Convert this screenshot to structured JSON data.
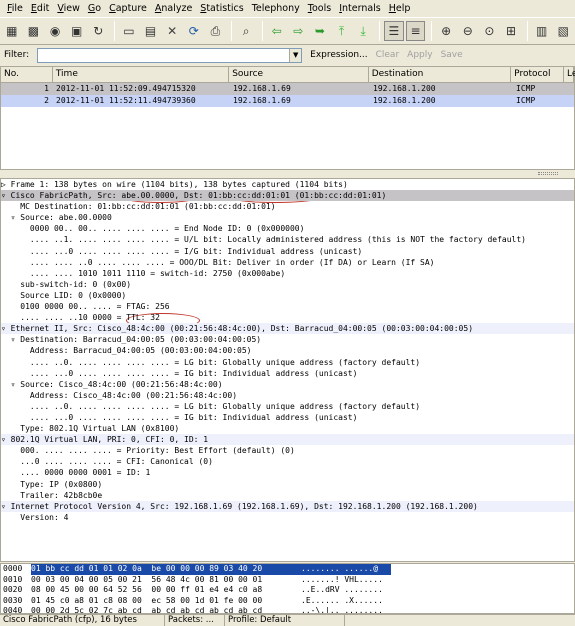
{
  "menu": [
    {
      "u": "F",
      "rest": "ile"
    },
    {
      "u": "E",
      "rest": "dit"
    },
    {
      "u": "V",
      "rest": "iew"
    },
    {
      "u": "G",
      "rest": "o"
    },
    {
      "u": "C",
      "rest": "apture"
    },
    {
      "u": "A",
      "rest": "nalyze"
    },
    {
      "u": "S",
      "rest": "tatistics"
    },
    {
      "u": "",
      "rest": "Telephony"
    },
    {
      "u": "T",
      "rest": "ools"
    },
    {
      "u": "I",
      "rest": "nternals"
    },
    {
      "u": "H",
      "rest": "elp"
    }
  ],
  "toolbar_icons": [
    "interface-list-icon",
    "capture-options-icon",
    "start-capture-icon",
    "stop-capture-icon",
    "restart-capture-icon",
    "open-file-icon",
    "save-file-icon",
    "close-file-icon",
    "reload-icon",
    "print-icon",
    "find-icon",
    "go-back-icon",
    "go-forward-icon",
    "go-to-packet-icon",
    "go-first-icon",
    "go-last-icon",
    "colorize-icon",
    "autoscroll-icon",
    "zoom-in-icon",
    "zoom-out-icon",
    "normal-size-icon",
    "resize-columns-icon",
    "capture-filters-icon",
    "display-filters-icon"
  ],
  "filter": {
    "label": "Filter:",
    "value": "",
    "expression": "Expression...",
    "clear": "Clear",
    "apply": "Apply",
    "save": "Save"
  },
  "packet_list": {
    "columns": [
      "No.",
      "Time",
      "Source",
      "Destination",
      "Protocol",
      "Le"
    ],
    "rows": [
      {
        "no": "1",
        "time": "2012-11-01 11:52:09.494715320",
        "src": "192.168.1.69",
        "dst": "192.168.1.200",
        "proto": "ICMP"
      },
      {
        "no": "2",
        "time": "2012-11-01 11:52:11.494739360",
        "src": "192.168.1.69",
        "dst": "192.168.1.200",
        "proto": "ICMP"
      }
    ]
  },
  "tree": [
    {
      "t": "▷ Frame 1: 138 bytes on wire (1104 bits), 138 bytes captured (1104 bits)"
    },
    {
      "t": "▿ Cisco FabricPath, Src: abe.00.0000, Dst: 01:bb:cc:dd:01:01 (01:bb:cc:dd:01:01)",
      "sel": true
    },
    {
      "t": "    MC Destination: 01:bb:cc:dd:01:01 (01:bb:cc:dd:01:01)"
    },
    {
      "t": "  ▿ Source: abe.00.0000"
    },
    {
      "t": "      0000 00.. 00.. .... .... .... = End Node ID: 0 (0x000000)"
    },
    {
      "t": "      .... ..1. .... .... .... .... = U/L bit: Locally administered address (this is NOT the factory default)"
    },
    {
      "t": "      .... ...0 .... .... .... .... = I/G bit: Individual address (unicast)"
    },
    {
      "t": "      .... .... ..0 .... .... .... = OOO/DL Bit: Deliver in order (If DA) or Learn (If SA)"
    },
    {
      "t": "      .... .... 1010 1011 1110 = switch-id: 2750 (0x000abe)"
    },
    {
      "t": "    sub-switch-id: 0 (0x00)"
    },
    {
      "t": "    Source LID: 0 (0x0000)"
    },
    {
      "t": "    0100 0000 00.. .... = FTAG: 256"
    },
    {
      "t": "    .... .... ..10 0000 = TTL: 32"
    },
    {
      "t": "▿ Ethernet II, Src: Cisco_48:4c:00 (00:21:56:48:4c:00), Dst: Barracud_04:00:05 (00:03:00:04:00:05)",
      "hdr": true
    },
    {
      "t": "  ▿ Destination: Barracud_04:00:05 (00:03:00:04:00:05)"
    },
    {
      "t": "      Address: Barracud_04:00:05 (00:03:00:04:00:05)"
    },
    {
      "t": "      .... ..0. .... .... .... .... = LG bit: Globally unique address (factory default)"
    },
    {
      "t": "      .... ...0 .... .... .... .... = IG bit: Individual address (unicast)"
    },
    {
      "t": "  ▿ Source: Cisco_48:4c:00 (00:21:56:48:4c:00)"
    },
    {
      "t": "      Address: Cisco_48:4c:00 (00:21:56:48:4c:00)"
    },
    {
      "t": "      .... ..0. .... .... .... .... = LG bit: Globally unique address (factory default)"
    },
    {
      "t": "      .... ...0 .... .... .... .... = IG bit: Individual address (unicast)"
    },
    {
      "t": "    Type: 802.1Q Virtual LAN (0x8100)"
    },
    {
      "t": "▿ 802.1Q Virtual LAN, PRI: 0, CFI: 0, ID: 1",
      "hdr": true
    },
    {
      "t": "    000. .... .... .... = Priority: Best Effort (default) (0)"
    },
    {
      "t": "    ...0 .... .... .... = CFI: Canonical (0)"
    },
    {
      "t": "    .... 0000 0000 0001 = ID: 1"
    },
    {
      "t": "    Type: IP (0x0800)"
    },
    {
      "t": "    Trailer: 42b8cb0e"
    },
    {
      "t": "▿ Internet Protocol Version 4, Src: 192.168.1.69 (192.168.1.69), Dst: 192.168.1.200 (192.168.1.200)",
      "hdr": true
    },
    {
      "t": "    Version: 4"
    }
  ],
  "hex": [
    {
      "off": "0000",
      "bytes": "01 bb cc dd 01 01 02 0a  be 00 00 00 89 03 40 20",
      "asc": "........ ......@ ",
      "sel": true
    },
    {
      "off": "0010",
      "bytes": "00 03 00 04 00 05 00 21  56 48 4c 00 81 00 00 01",
      "asc": ".......! VHL....."
    },
    {
      "off": "0020",
      "bytes": "08 00 45 00 00 64 52 56  00 00 ff 01 e4 e4 c0 a8",
      "asc": "..E..dRV ........"
    },
    {
      "off": "0030",
      "bytes": "01 45 c0 a8 01 c8 08 00  ec 58 00 1d 01 fe 00 00",
      "asc": ".E...... .X......"
    },
    {
      "off": "0040",
      "bytes": "00 00 2d 5c 02 7c ab cd  ab cd ab cd ab cd ab cd",
      "asc": "..-\\.|.. ........"
    }
  ],
  "status": {
    "field": "Cisco FabricPath (cfp), 16 bytes",
    "packets": "Packets: ...",
    "profile": "Profile: Default"
  }
}
